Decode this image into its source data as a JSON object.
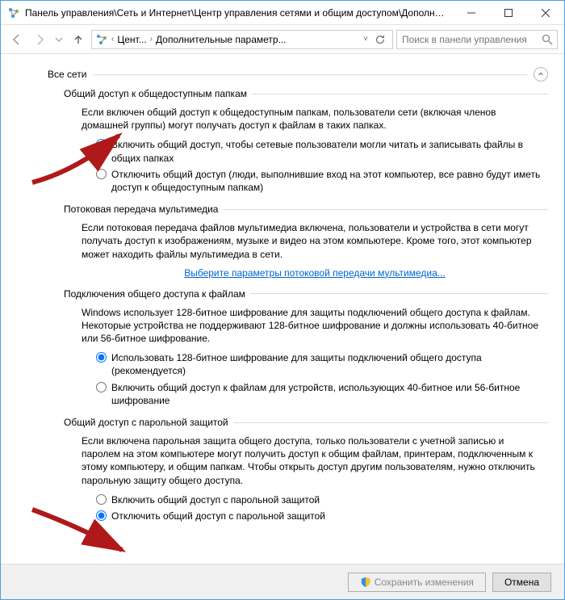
{
  "titlebar": {
    "title": "Панель управления\\Сеть и Интернет\\Центр управления сетями и общим доступом\\Дополни..."
  },
  "breadcrumb": {
    "part1": "Цент...",
    "part2": "Дополнительные параметр..."
  },
  "search": {
    "placeholder": "Поиск в панели управления"
  },
  "profile": {
    "title": "Все сети"
  },
  "sections": {
    "public_folders": {
      "title": "Общий доступ к общедоступным папкам",
      "desc": "Если включен общий доступ к общедоступным папкам, пользователи сети (включая членов домашней группы) могут получать доступ к файлам в таких папках.",
      "opt_on": "Включить общий доступ, чтобы сетевые пользователи могли читать и записывать файлы в общих папках",
      "opt_off": "Отключить общий доступ (люди, выполнившие вход на этот компьютер, все равно будут иметь доступ к общедоступным папкам)"
    },
    "media": {
      "title": "Потоковая передача мультимедиа",
      "desc": "Если потоковая передача файлов мультимедиа включена, пользователи и устройства в сети могут получать доступ к изображениям, музыке и видео на этом компьютере. Кроме того, этот компьютер может находить файлы мультимедиа в сети.",
      "link": "Выберите параметры потоковой передачи мультимедиа..."
    },
    "encryption": {
      "title": "Подключения общего доступа к файлам",
      "desc": "Windows использует 128-битное шифрование для защиты подключений общего доступа к файлам. Некоторые устройства не поддерживают 128-битное шифрование и должны использовать 40-битное или 56-битное шифрование.",
      "opt_128": "Использовать 128-битное шифрование для защиты подключений общего доступа (рекомендуется)",
      "opt_40": "Включить общий доступ к файлам для устройств, использующих 40-битное или 56-битное шифрование"
    },
    "password": {
      "title": "Общий доступ с парольной защитой",
      "desc": "Если включена парольная защита общего доступа, только пользователи с учетной записью и паролем на этом компьютере могут получить доступ к общим файлам, принтерам, подключенным к этому компьютеру, и общим папкам. Чтобы открыть доступ другим пользователям, нужно отключить парольную защиту общего доступа.",
      "opt_on": "Включить общий доступ с парольной защитой",
      "opt_off": "Отключить общий доступ с парольной защитой"
    }
  },
  "buttons": {
    "save": "Сохранить изменения",
    "cancel": "Отмена"
  }
}
